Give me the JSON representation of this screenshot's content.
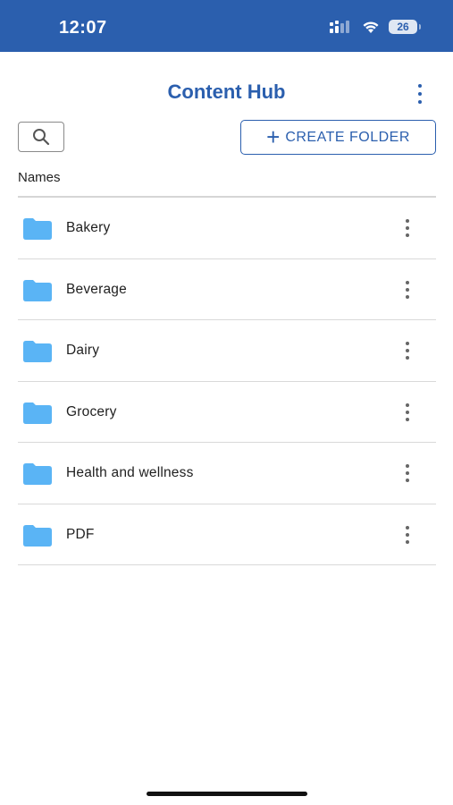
{
  "status_bar": {
    "time": "12:07",
    "battery": "26",
    "background": "#2b5fae"
  },
  "header": {
    "title": "Content Hub",
    "menu_icon": "more-vertical-icon"
  },
  "toolbar": {
    "search_icon": "search-icon",
    "create_plus": "+",
    "create_label": "CREATE FOLDER"
  },
  "list": {
    "column_header": "Names",
    "folders": [
      {
        "name": "Bakery"
      },
      {
        "name": "Beverage"
      },
      {
        "name": "Dairy"
      },
      {
        "name": "Grocery"
      },
      {
        "name": "Health and wellness"
      },
      {
        "name": "PDF"
      }
    ]
  },
  "colors": {
    "accent": "#2b5fae",
    "folder": "#5ab4f5"
  }
}
